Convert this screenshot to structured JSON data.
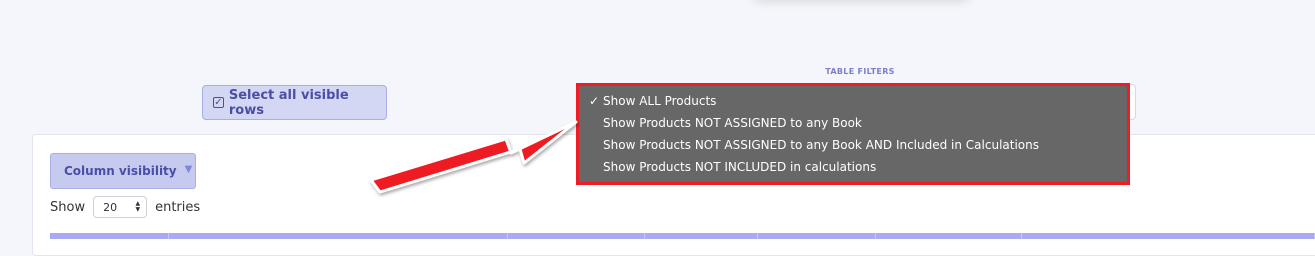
{
  "actions": {
    "select_all_label": "Select all visible rows",
    "select_all_icon": "checked-checkbox-icon"
  },
  "filters": {
    "label": "TABLE FILTERS",
    "selected_index": 0,
    "options": [
      {
        "label": "Show ALL Products",
        "checked": true
      },
      {
        "label": "Show Products NOT ASSIGNED to any Book",
        "checked": false
      },
      {
        "label": "Show Products NOT ASSIGNED to any Book AND Included in Calculations",
        "checked": false
      },
      {
        "label": "Show Products NOT INCLUDED in calculations",
        "checked": false
      }
    ],
    "check_mark": "✓"
  },
  "table_controls": {
    "column_visibility_label": "Column visibility",
    "show_label": "Show",
    "entries_value": "20",
    "entries_label": "entries"
  },
  "colors": {
    "accent": "#4a4fa6",
    "button_bg": "#d4d7f3",
    "table_header": "#a9aaf2",
    "highlight_border": "#ee1c24",
    "dropdown_bg": "#676767",
    "annotation_arrow": "#ee1c24"
  }
}
